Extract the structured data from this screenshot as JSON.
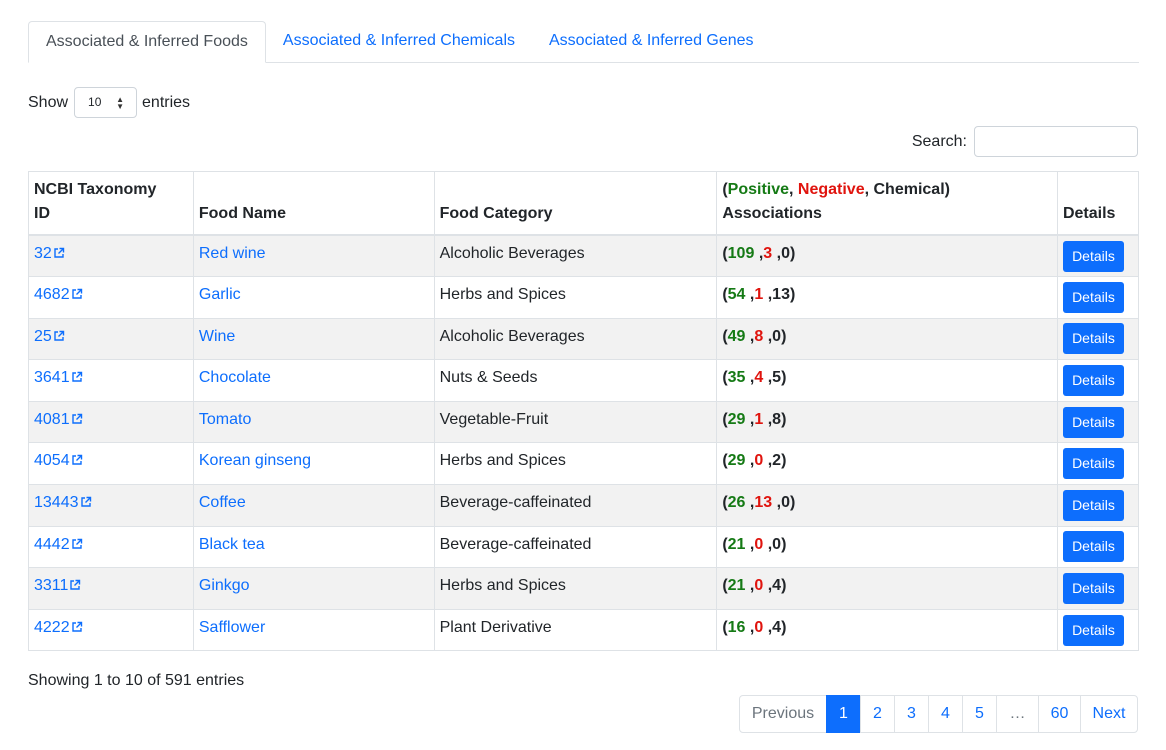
{
  "tabs": [
    {
      "label": "Associated & Inferred Foods",
      "active": true
    },
    {
      "label": "Associated & Inferred Chemicals",
      "active": false
    },
    {
      "label": "Associated & Inferred Genes",
      "active": false
    }
  ],
  "length": {
    "show_label": "Show",
    "selected": "10",
    "entries_label": "entries"
  },
  "search": {
    "label": "Search:",
    "value": ""
  },
  "table": {
    "headers": {
      "taxonomy_line1": "NCBI Taxonomy",
      "taxonomy_line2": "ID",
      "food_name": "Food Name",
      "food_category": "Food Category",
      "assoc_open": "(",
      "assoc_positive": "Positive",
      "assoc_sep1": ", ",
      "assoc_negative": "Negative",
      "assoc_sep2": ", ",
      "assoc_chemical": "Chemical",
      "assoc_close": ")",
      "assoc_line2": "Associations",
      "details": "Details"
    },
    "rows": [
      {
        "id": "32",
        "name": "Red wine",
        "category": "Alcoholic Beverages",
        "positive": "109",
        "negative": "3",
        "chemical": "0",
        "button": "Details"
      },
      {
        "id": "4682",
        "name": "Garlic",
        "category": "Herbs and Spices",
        "positive": "54",
        "negative": "1",
        "chemical": "13",
        "button": "Details"
      },
      {
        "id": "25",
        "name": "Wine",
        "category": "Alcoholic Beverages",
        "positive": "49",
        "negative": "8",
        "chemical": "0",
        "button": "Details"
      },
      {
        "id": "3641",
        "name": "Chocolate",
        "category": "Nuts & Seeds",
        "positive": "35",
        "negative": "4",
        "chemical": "5",
        "button": "Details"
      },
      {
        "id": "4081",
        "name": "Tomato",
        "category": "Vegetable-Fruit",
        "positive": "29",
        "negative": "1",
        "chemical": "8",
        "button": "Details"
      },
      {
        "id": "4054",
        "name": "Korean ginseng",
        "category": "Herbs and Spices",
        "positive": "29",
        "negative": "0",
        "chemical": "2",
        "button": "Details"
      },
      {
        "id": "13443",
        "name": "Coffee",
        "category": "Beverage-caffeinated",
        "positive": "26",
        "negative": "13",
        "chemical": "0",
        "button": "Details"
      },
      {
        "id": "4442",
        "name": "Black tea",
        "category": "Beverage-caffeinated",
        "positive": "21",
        "negative": "0",
        "chemical": "0",
        "button": "Details"
      },
      {
        "id": "3311",
        "name": "Ginkgo",
        "category": "Herbs and Spices",
        "positive": "21",
        "negative": "0",
        "chemical": "4",
        "button": "Details"
      },
      {
        "id": "4222",
        "name": "Safflower",
        "category": "Plant Derivative",
        "positive": "16",
        "negative": "0",
        "chemical": "4",
        "button": "Details"
      }
    ]
  },
  "info": "Showing 1 to 10 of 591 entries",
  "pagination": [
    {
      "label": "Previous",
      "state": "disabled"
    },
    {
      "label": "1",
      "state": "active"
    },
    {
      "label": "2",
      "state": "normal"
    },
    {
      "label": "3",
      "state": "normal"
    },
    {
      "label": "4",
      "state": "normal"
    },
    {
      "label": "5",
      "state": "normal"
    },
    {
      "label": "…",
      "state": "dots"
    },
    {
      "label": "60",
      "state": "normal"
    },
    {
      "label": "Next",
      "state": "normal"
    }
  ],
  "colors": {
    "link": "#0d6efd",
    "positive": "#157a15",
    "negative": "#e0140e",
    "button": "#0d6efd"
  },
  "icons": {
    "external_link": "external-link-icon",
    "select_caret": "updown-caret-icon"
  }
}
